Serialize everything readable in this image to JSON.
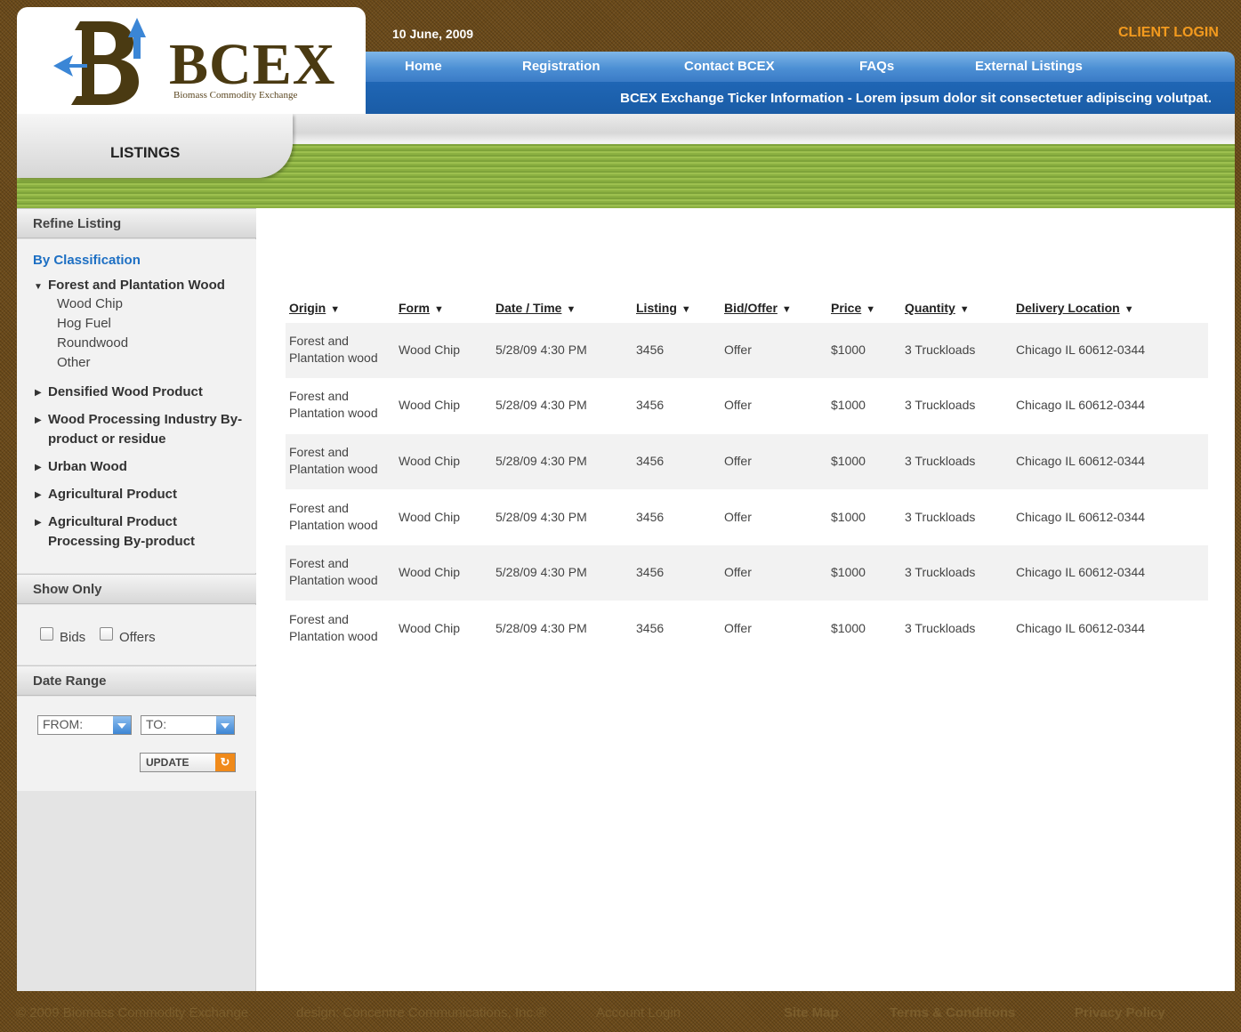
{
  "brand": {
    "name_b": "BC",
    "name_x": "EX",
    "subtitle": "Biomass Commodity Exchange"
  },
  "header": {
    "date": "10 June, 2009",
    "client_login": "CLIENT LOGIN",
    "nav": [
      "Home",
      "Registration",
      "Contact BCEX",
      "FAQs",
      "External Listings"
    ],
    "ticker": "BCEX Exchange Ticker Information - Lorem ipsum dolor sit consectetuer adipiscing volutpat."
  },
  "page_title": "LISTINGS",
  "sidebar": {
    "refine_title": "Refine Listing",
    "by_classification": "By Classification",
    "categories": [
      {
        "label": "Forest and Plantation Wood",
        "expanded": true,
        "children": [
          "Wood Chip",
          "Hog Fuel",
          "Roundwood",
          "Other"
        ]
      },
      {
        "label": "Densified Wood Product"
      },
      {
        "label": "Wood Processing Industry By-product or residue"
      },
      {
        "label": "Urban Wood"
      },
      {
        "label": "Agricultural Product"
      },
      {
        "label": "Agricultural Product Processing By-product"
      }
    ],
    "show_only_title": "Show Only",
    "bids_label": "Bids",
    "offers_label": "Offers",
    "date_range_title": "Date Range",
    "from_label": "FROM:",
    "to_label": "TO:",
    "update_label": "UPDATE"
  },
  "table": {
    "headers": [
      "Origin",
      "Form",
      "Date / Time",
      "Listing",
      "Bid/Offer",
      "Price",
      "Quantity",
      "Delivery Location"
    ],
    "rows": [
      [
        "Forest and",
        "Plantation wood",
        "Wood Chip",
        "5/28/09 4:30 PM",
        "3456",
        "Offer",
        "$1000",
        "3 Truckloads",
        "Chicago IL 60612-0344"
      ],
      [
        "Forest and",
        "Plantation wood",
        "Wood Chip",
        "5/28/09 4:30 PM",
        "3456",
        "Offer",
        "$1000",
        "3 Truckloads",
        "Chicago IL 60612-0344"
      ],
      [
        "Forest and",
        "Plantation wood",
        "Wood Chip",
        "5/28/09 4:30 PM",
        "3456",
        "Offer",
        "$1000",
        "3 Truckloads",
        "Chicago IL 60612-0344"
      ],
      [
        "Forest and",
        "Plantation wood",
        "Wood Chip",
        "5/28/09 4:30 PM",
        "3456",
        "Offer",
        "$1000",
        "3 Truckloads",
        "Chicago IL 60612-0344"
      ],
      [
        "Forest and",
        "Plantation wood",
        "Wood Chip",
        "5/28/09 4:30 PM",
        "3456",
        "Offer",
        "$1000",
        "3 Truckloads",
        "Chicago IL 60612-0344"
      ],
      [
        "Forest and",
        "Plantation wood",
        "Wood Chip",
        "5/28/09 4:30 PM",
        "3456",
        "Offer",
        "$1000",
        "3 Truckloads",
        "Chicago IL 60612-0344"
      ]
    ]
  },
  "footer": [
    "© 2009 Biomass Commodity Exchange",
    "design: Concentre Communications, Inc.®",
    "Account Login",
    "Site Map",
    "Terms & Conditions",
    "Privacy Policy"
  ]
}
